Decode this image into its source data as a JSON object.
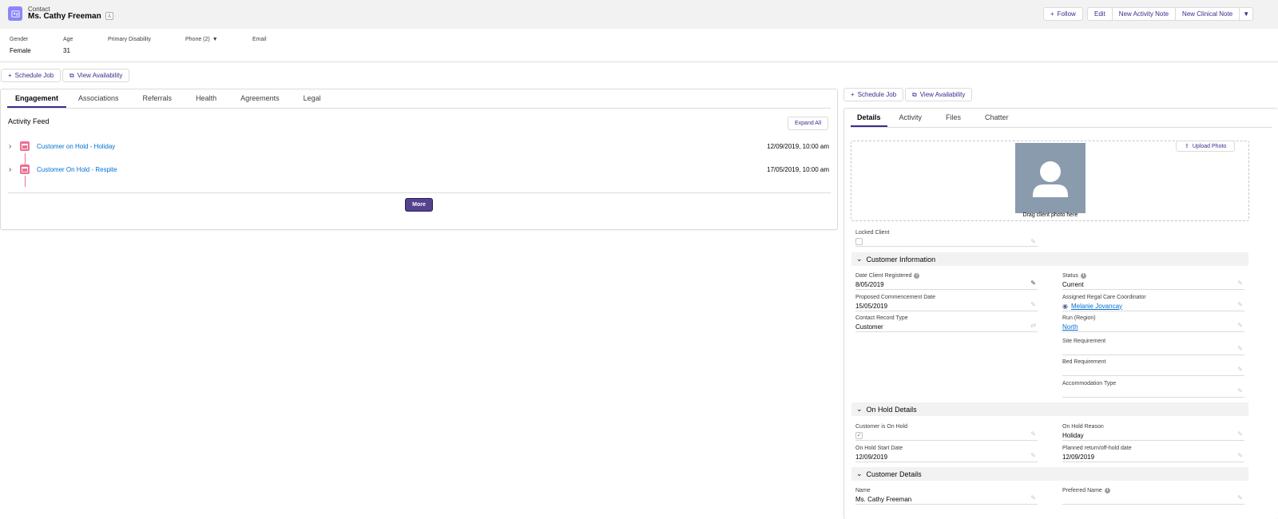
{
  "header": {
    "object_label": "Contact",
    "title": "Ms. Cathy Freeman",
    "follow_label": "Follow",
    "actions": [
      "Edit",
      "New Activity Note",
      "New Clinical Note"
    ]
  },
  "highlights": [
    {
      "label": "Gender",
      "value": "Female"
    },
    {
      "label": "Age",
      "value": "31"
    },
    {
      "label": "Primary Disability",
      "value": ""
    },
    {
      "label": "Phone (2)",
      "value": ""
    },
    {
      "label": "Email",
      "value": ""
    }
  ],
  "quick_actions": {
    "schedule": "Schedule Job",
    "availability": "View Availability"
  },
  "left_tabs": [
    "Engagement",
    "Associations",
    "Referrals",
    "Health",
    "Agreements",
    "Legal"
  ],
  "activity": {
    "title": "Activity Feed",
    "expand_label": "Expand All",
    "items": [
      {
        "title": "Customer on Hold - Holiday",
        "date": "12/09/2019, 10:00 am"
      },
      {
        "title": "Customer On Hold - Respite",
        "date": "17/05/2019, 10:00 am"
      }
    ],
    "more_label": "More"
  },
  "right_tabs": [
    "Details",
    "Activity",
    "Files",
    "Chatter"
  ],
  "photo": {
    "upload_label": "Upload Photo",
    "drag_text": "Drag client photo here"
  },
  "locked": {
    "label": "Locked Client"
  },
  "sections": {
    "customer_info": "Customer Information",
    "on_hold": "On Hold Details",
    "customer_details": "Customer Details"
  },
  "fields": {
    "date_registered": {
      "label": "Date Client Registered",
      "value": "8/05/2019"
    },
    "status": {
      "label": "Status",
      "value": "Current"
    },
    "proposed_date": {
      "label": "Proposed Commencement Date",
      "value": "15/05/2019"
    },
    "coordinator": {
      "label": "Assigned Regal Care Coordinator",
      "value": "Melanie Jovancay"
    },
    "record_type": {
      "label": "Contact Record Type",
      "value": "Customer"
    },
    "run_region": {
      "label": "Run (Region)",
      "value": "North"
    },
    "site_req": {
      "label": "Site Requirement",
      "value": ""
    },
    "bed_req": {
      "label": "Bed Requirement",
      "value": ""
    },
    "accom_type": {
      "label": "Accommodation Type",
      "value": ""
    },
    "on_hold": {
      "label": "Customer is On Hold"
    },
    "on_hold_reason": {
      "label": "On Hold Reason",
      "value": "Holiday"
    },
    "on_hold_start": {
      "label": "On Hold Start Date",
      "value": "12/09/2019"
    },
    "planned_return": {
      "label": "Planned return/off-hold date",
      "value": "12/09/2019"
    },
    "name": {
      "label": "Name",
      "value": "Ms. Cathy Freeman"
    },
    "preferred_name": {
      "label": "Preferred Name",
      "value": ""
    }
  }
}
